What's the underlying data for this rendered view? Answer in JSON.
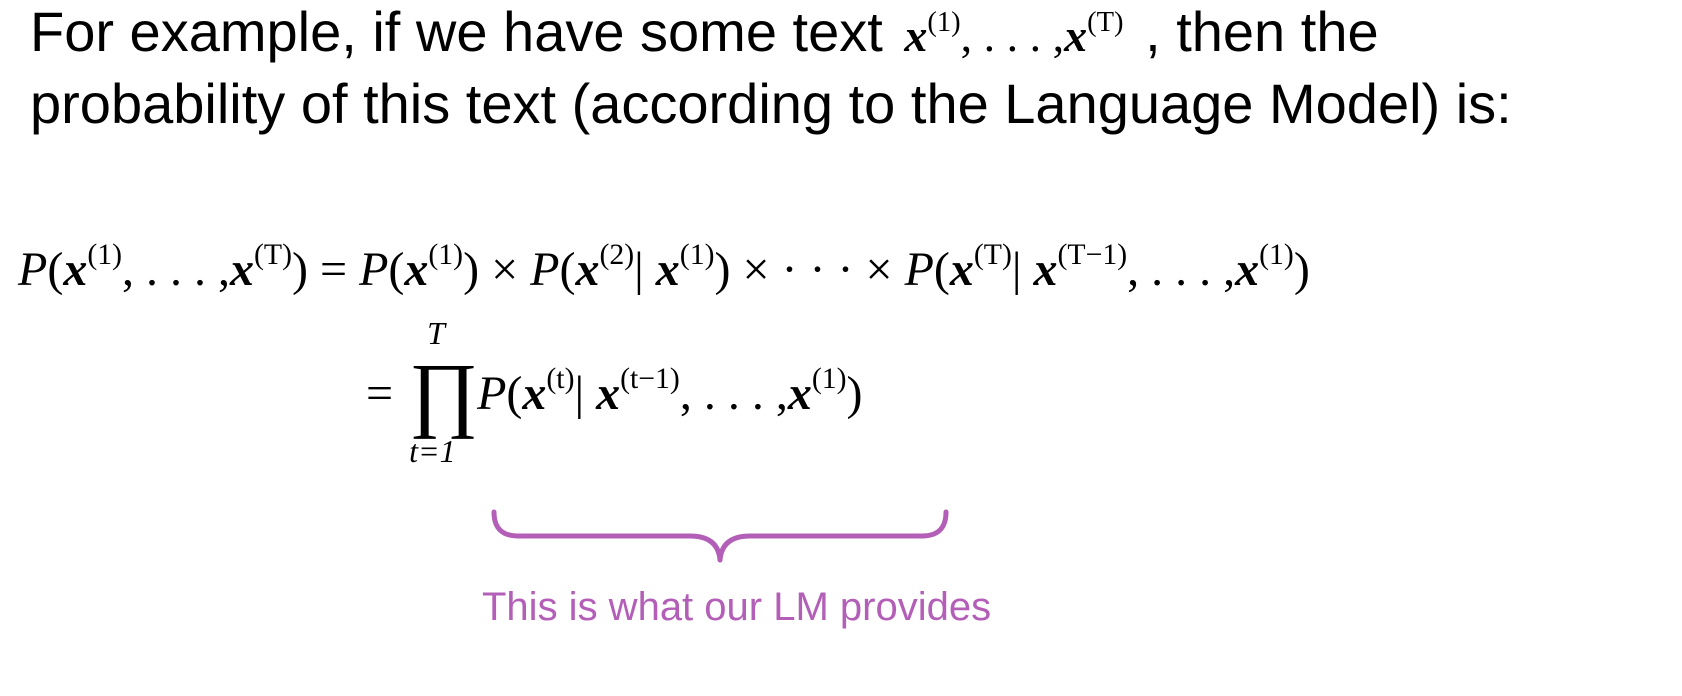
{
  "intro": {
    "line1_before": "For example, if we have some text",
    "line1_after": ", then the",
    "line2": "probability of this text (according to the Language Model) is:"
  },
  "math": {
    "x": "x",
    "P": "P",
    "open": "(",
    "close": ")",
    "comma_dots": ", . . . ,",
    "times": "×",
    "cdots": "· · ·",
    "equals": "=",
    "bar": "|",
    "prod": "∏",
    "sup_1": "(1)",
    "sup_2": "(2)",
    "sup_T": "(T)",
    "sup_T_minus_1": "(T−1)",
    "sup_t": "(t)",
    "sup_t_minus_1": "(t−1)",
    "prod_upper": "T",
    "prod_lower": "t=1"
  },
  "annotation": {
    "text": "This is what our LM provides",
    "color": "#b35fb8"
  }
}
